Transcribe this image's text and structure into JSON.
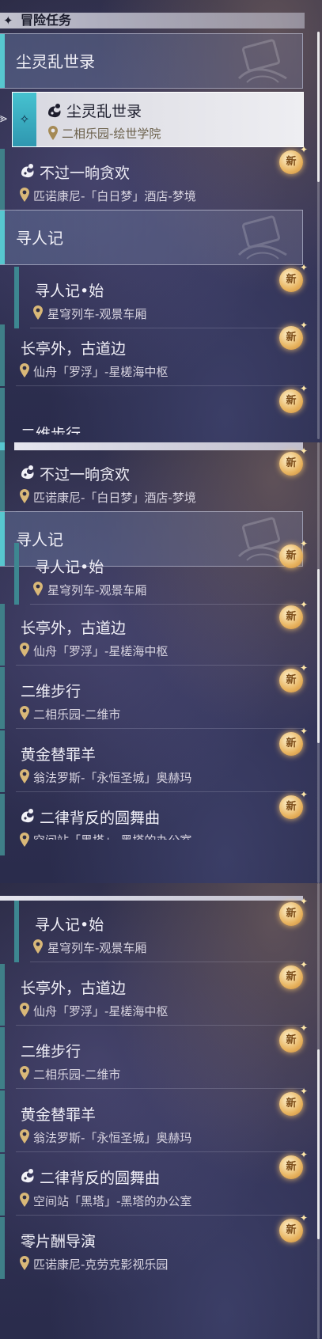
{
  "section": {
    "glyph": "✦",
    "title": "冒险任务"
  },
  "badge": {
    "text": "新"
  },
  "panel1": {
    "group_a": "尘灵乱世录",
    "selected": {
      "name": "尘灵乱世录",
      "location": "二相乐园-绘世学院"
    },
    "quest1": {
      "name": "不过一晌贪欢",
      "location": "匹诺康尼-「白日梦」酒店-梦境"
    },
    "group_b": "寻人记",
    "quest2": {
      "name": "寻人记•始",
      "location": "星穹列车-观景车厢"
    },
    "quest3": {
      "name": "长亭外，古道边",
      "location": "仙舟「罗浮」-星槎海中枢"
    },
    "quest4_partial": "二维步行"
  },
  "panel2": {
    "quest1": {
      "name": "不过一晌贪欢",
      "location": "匹诺康尼-「白日梦」酒店-梦境"
    },
    "group_b": "寻人记",
    "quest2": {
      "name": "寻人记•始",
      "location": "星穹列车-观景车厢"
    },
    "quest3": {
      "name": "长亭外，古道边",
      "location": "仙舟「罗浮」-星槎海中枢"
    },
    "quest4": {
      "name": "二维步行",
      "location": "二相乐园-二维市"
    },
    "quest5": {
      "name": "黄金替罪羊",
      "location": "翁法罗斯-「永恒圣城」奥赫玛"
    },
    "quest6": {
      "name": "二律背反的圆舞曲",
      "location": "空间站「黑塔」-黑塔的办公室"
    }
  },
  "panel3": {
    "quest2": {
      "name": "寻人记•始",
      "location": "星穹列车-观景车厢"
    },
    "quest3": {
      "name": "长亭外，古道边",
      "location": "仙舟「罗浮」-星槎海中枢"
    },
    "quest4": {
      "name": "二维步行",
      "location": "二相乐园-二维市"
    },
    "quest5": {
      "name": "黄金替罪羊",
      "location": "翁法罗斯-「永恒圣城」奥赫玛"
    },
    "quest6": {
      "name": "二律背反的圆舞曲",
      "location": "空间站「黑塔」-黑塔的办公室"
    },
    "quest7": {
      "name": "零片酬导演",
      "location": "匹诺康尼-克劳克影视乐园"
    }
  },
  "colors": {
    "accent": "#57c7cf",
    "badge": "#e8b460",
    "stripe": "#3f7f88"
  },
  "icons": [
    "quest-type-icon",
    "location-pin-icon",
    "new-badge-icon",
    "diamond-marker-icon",
    "pointer-arrow-icon"
  ]
}
